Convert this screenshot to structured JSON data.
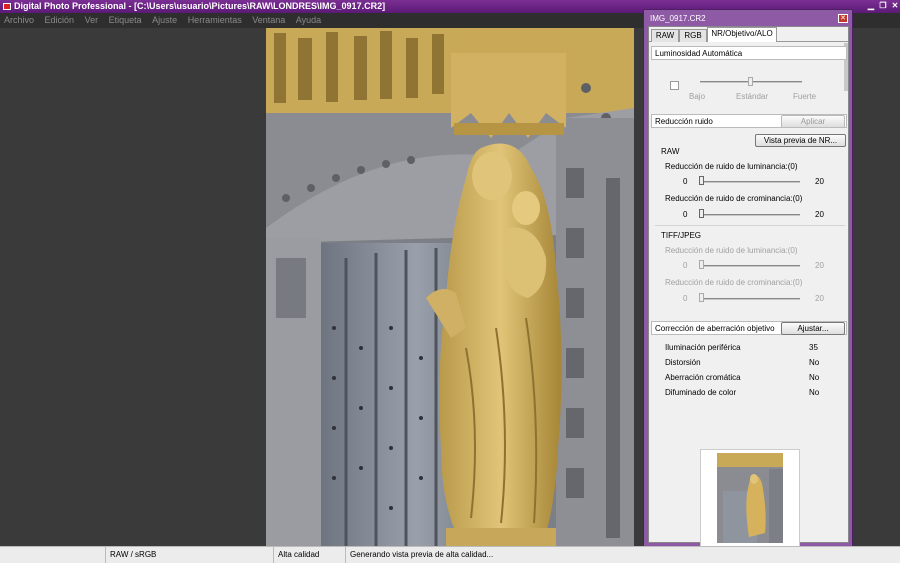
{
  "window": {
    "title": "Digital Photo Professional - [C:\\Users\\usuario\\Pictures\\RAW\\LONDRES\\IMG_0917.CR2]"
  },
  "menu": [
    "Archivo",
    "Edición",
    "Ver",
    "Etiqueta",
    "Ajuste",
    "Herramientas",
    "Ventana",
    "Ayuda"
  ],
  "status": {
    "color_space": "RAW / sRGB",
    "quality": "Alta calidad",
    "message": "Generando vista previa de alta calidad..."
  },
  "palette": {
    "title": "IMG_0917.CR2",
    "close_glyph": "✕",
    "tabs": [
      "RAW",
      "RGB",
      "NR/Objetivo/ALO"
    ],
    "active_tab": "NR/Objetivo/ALO",
    "auto_lighting": {
      "heading": "Luminosidad Automática",
      "checked": false,
      "labels": [
        "Bajo",
        "Estándar",
        "Fuerte"
      ]
    },
    "noise": {
      "heading": "Reducción ruido",
      "apply_button": "Aplicar",
      "preview_button": "Vista previa de NR...",
      "raw_label": "RAW",
      "raw_lum_label": "Reducción de ruido de luminancia:(0)",
      "raw_lum_value": 0,
      "raw_chroma_label": "Reducción de ruido de crominancia:(0)",
      "raw_chroma_value": 0,
      "tiff_label": "TIFF/JPEG",
      "tiff_lum_label": "Reducción de ruido de luminancia:(0)",
      "tiff_chroma_label": "Reducción de ruido de crominancia:(0)",
      "min": "0",
      "max": "20"
    },
    "lens": {
      "heading": "Corrección de aberración objetivo",
      "adjust_button": "Ajustar...",
      "rows": [
        {
          "name": "Iluminación periférica",
          "value": "35"
        },
        {
          "name": "Distorsión",
          "value": "No"
        },
        {
          "name": "Aberración cromática",
          "value": "No"
        },
        {
          "name": "Difuminado de color",
          "value": "No"
        }
      ]
    }
  },
  "colors": {
    "titlebar": "#6a2485",
    "palette_frame": "#8e5aa5",
    "background": "#3a3a3a",
    "stone": "#d6b25c"
  },
  "icons": {
    "app": "dpp-app-icon",
    "minimize": "minimize-icon",
    "restore": "restore-icon",
    "close": "close-icon"
  }
}
